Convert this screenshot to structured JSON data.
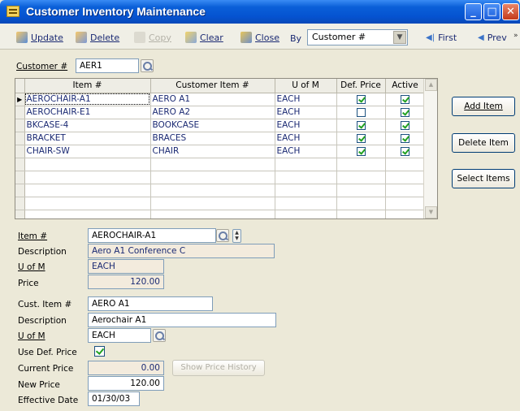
{
  "window": {
    "title": "Customer Inventory Maintenance"
  },
  "toolbar": {
    "update": "Update",
    "delete": "Delete",
    "copy": "Copy",
    "clear": "Clear",
    "close": "Close",
    "by_label": "By",
    "by_value": "Customer #",
    "first": "First",
    "prev": "Prev"
  },
  "customer": {
    "label": "Customer #",
    "value": "AER1"
  },
  "grid": {
    "columns": [
      "Item #",
      "Customer Item #",
      "U of M",
      "Def. Price",
      "Active"
    ],
    "rows": [
      {
        "item": "AEROCHAIR-A1",
        "cust_item": "AERO A1",
        "uom": "EACH",
        "def_price": true,
        "active": true
      },
      {
        "item": "AEROCHAIR-E1",
        "cust_item": "AERO A2",
        "uom": "EACH",
        "def_price": false,
        "active": true
      },
      {
        "item": "BKCASE-4",
        "cust_item": "BOOKCASE",
        "uom": "EACH",
        "def_price": true,
        "active": true
      },
      {
        "item": "BRACKET",
        "cust_item": "BRACES",
        "uom": "EACH",
        "def_price": true,
        "active": true
      },
      {
        "item": "CHAIR-SW",
        "cust_item": "CHAIR",
        "uom": "EACH",
        "def_price": true,
        "active": true
      }
    ],
    "empty_rows": 5
  },
  "side_buttons": {
    "add_item": "Add Item",
    "delete_item": "Delete Item",
    "select_items": "Select Items"
  },
  "item_detail": {
    "item_label": "Item #",
    "item_value": "AEROCHAIR-A1",
    "description_label": "Description",
    "description_value": "Aero A1 Conference C",
    "uom_label": "U of M",
    "uom_value": "EACH",
    "price_label": "Price",
    "price_value": "120.00"
  },
  "customer_detail": {
    "cust_item_label": "Cust. Item #",
    "cust_item_value": "AERO A1",
    "description_label": "Description",
    "description_value": "Aerochair A1",
    "uom_label": "U of M",
    "uom_value": "EACH",
    "use_def_price_label": "Use Def. Price",
    "use_def_price": true,
    "current_price_label": "Current Price",
    "current_price_value": "0.00",
    "show_price_history": "Show Price History",
    "new_price_label": "New Price",
    "new_price_value": "120.00",
    "effective_date_label": "Effective Date",
    "effective_date_value": "01/30/03"
  },
  "colors": {
    "title_bar": "#0553d1",
    "readonly_field": "#f3ebdd",
    "grid_text": "#1b2a73",
    "check": "#21a121"
  },
  "icons": [
    "update-icon",
    "delete-icon",
    "copy-icon",
    "clear-icon",
    "close-icon",
    "first-icon",
    "prev-icon",
    "lookup-icon",
    "spin-icon"
  ]
}
